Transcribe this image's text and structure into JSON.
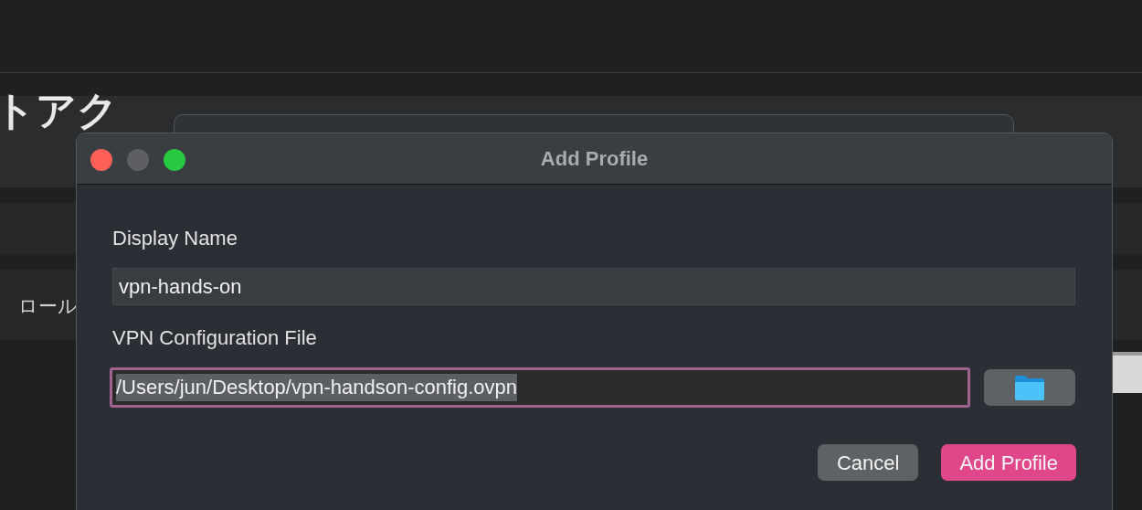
{
  "background": {
    "heading": "トアク",
    "row_text": "ロール"
  },
  "dialog": {
    "title": "Add Profile",
    "window_buttons": [
      {
        "kind": "close"
      },
      {
        "kind": "minimize"
      },
      {
        "kind": "zoom"
      }
    ],
    "fields": [
      {
        "label": "Display Name",
        "value": "vpn-hands-on",
        "focused": false,
        "text_selected": false
      },
      {
        "label": "VPN Configuration File",
        "value": "/Users/jun/Desktop/vpn-handson-config.ovpn",
        "focused": true,
        "text_selected": true,
        "browse": true
      }
    ],
    "buttons": [
      {
        "label": "Cancel",
        "default": false
      },
      {
        "label": "Add Profile",
        "default": true
      }
    ]
  }
}
